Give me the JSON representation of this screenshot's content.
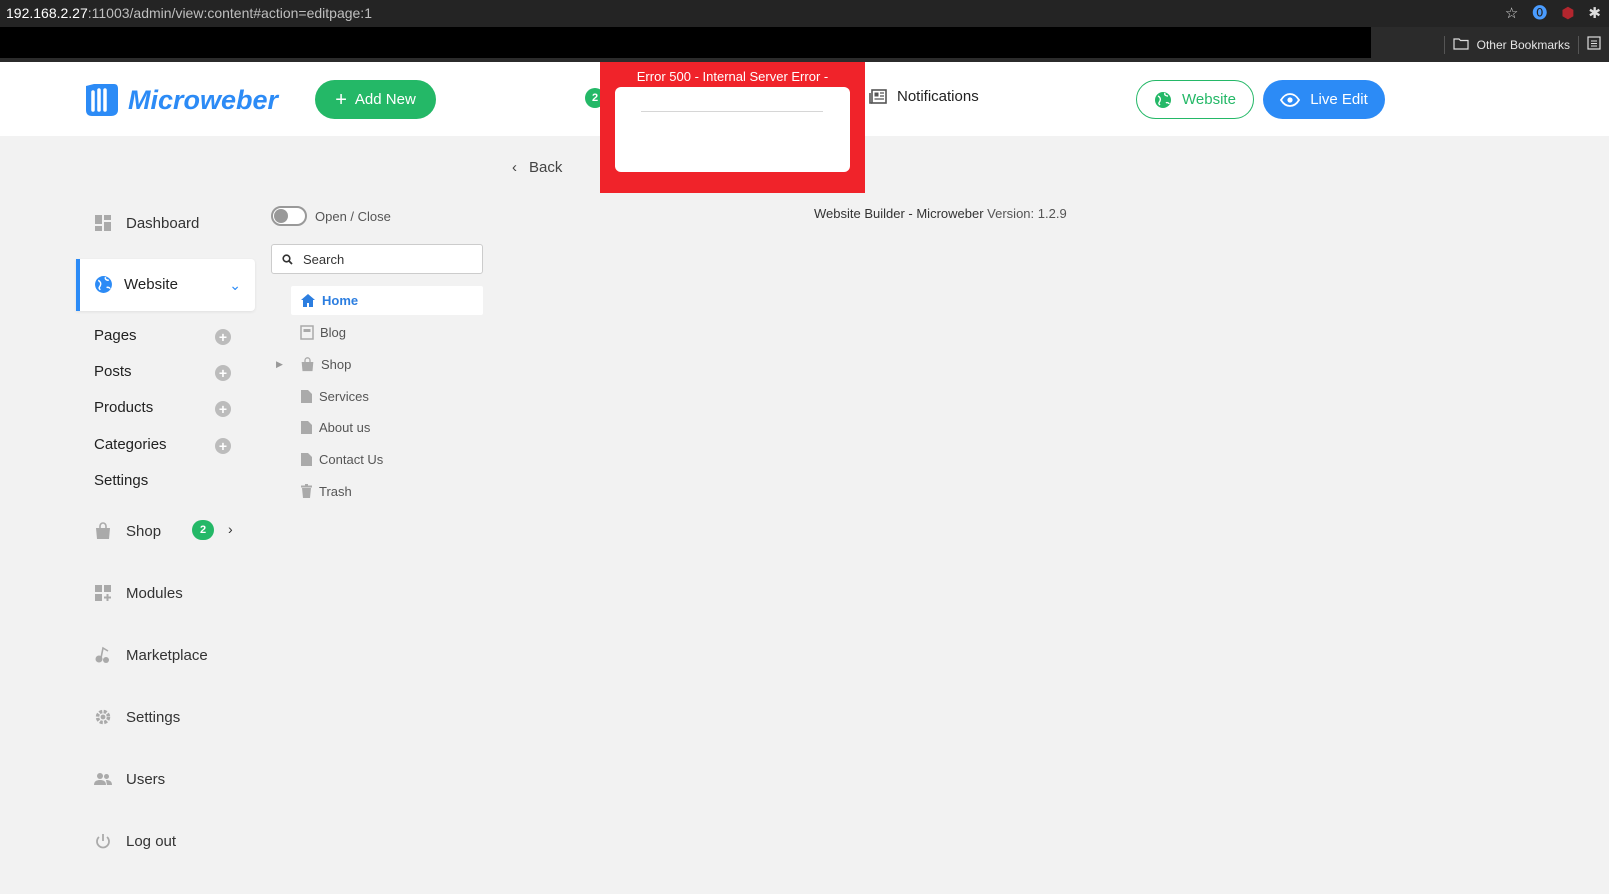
{
  "browser": {
    "url_host": "192.168.2.27",
    "url_rest": ":11003/admin/view:content#action=editpage:1",
    "bookmarks_label": "Other Bookmarks"
  },
  "header": {
    "logo_text": "Microweber",
    "add_new_label": "Add New",
    "badge_count": "2",
    "notifications_label": "Notifications",
    "website_label": "Website",
    "live_edit_label": "Live Edit"
  },
  "error": {
    "title": "Error 500 - Internal Server Error -"
  },
  "main": {
    "back_label": "Back",
    "version_prefix": "Website Builder - Microweber",
    "version_text": "Version: 1.2.9"
  },
  "sidebar": {
    "dashboard": "Dashboard",
    "website": "Website",
    "sub_items": [
      "Pages",
      "Posts",
      "Products",
      "Categories",
      "Settings"
    ],
    "shop": "Shop",
    "shop_badge": "2",
    "modules": "Modules",
    "marketplace": "Marketplace",
    "settings": "Settings",
    "users": "Users",
    "logout": "Log out"
  },
  "tree": {
    "toggle_label": "Open / Close",
    "search_placeholder": "Search",
    "items": [
      "Home",
      "Blog",
      "Shop",
      "Services",
      "About us",
      "Contact Us",
      "Trash"
    ]
  },
  "colors": {
    "accent_blue": "#2c8bf6",
    "accent_green": "#24b867",
    "error_red": "#f0232a"
  }
}
